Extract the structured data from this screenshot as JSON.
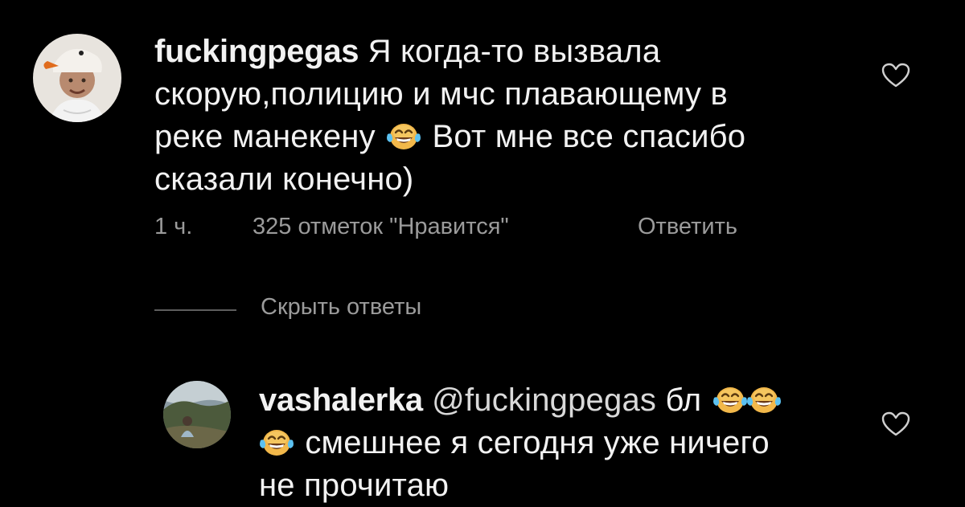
{
  "comments": [
    {
      "username": "fuckingpegas",
      "line1_text": "Я когда-то вызвала",
      "line2_text": "скорую,полицию и мчс плавающему в",
      "line3_before": "реке манекену",
      "line3_after": "Вот мне все спасибо",
      "line4_text": "сказали конечно)",
      "emoji": "face-with-tears-of-joy",
      "time": "1 ч.",
      "likes": "325 отметок \"Нравится\"",
      "reply_label": "Ответить"
    },
    {
      "username": "vashalerka",
      "mention": "@fuckingpegas",
      "line1_after_mention": "бл",
      "line2_text": "смешнее я сегодня уже ничего",
      "line3_text": "не прочитаю",
      "emoji": "face-with-tears-of-joy"
    }
  ],
  "replies": {
    "hide_label": "Скрыть ответы"
  },
  "icons": {
    "like": "heart-icon"
  },
  "colors": {
    "background": "#000000",
    "text": "#f2f2f2",
    "meta": "#9b9b9b",
    "divider": "#5e5e5e"
  }
}
